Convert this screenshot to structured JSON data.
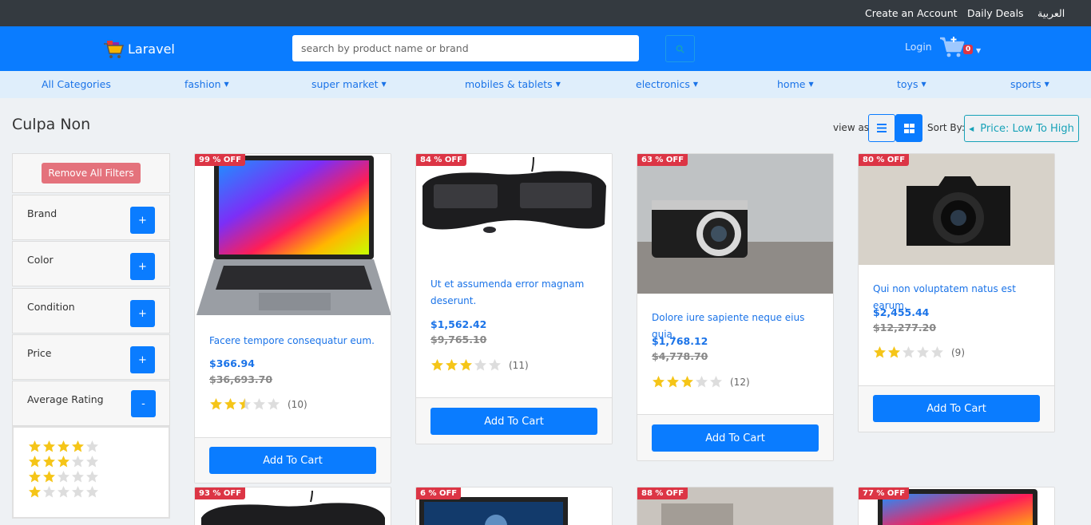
{
  "topbar": {
    "create_account": "Create an Account",
    "daily_deals": "Daily Deals",
    "arabic": "العربية"
  },
  "header": {
    "brand": "Laravel",
    "search_placeholder": "search by product name or brand",
    "login": "Login",
    "cart_count": "0"
  },
  "categories": [
    "All Categories",
    "fashion",
    "super market",
    "mobiles & tablets",
    "electronics",
    "home",
    "toys",
    "sports"
  ],
  "page": {
    "title": "Culpa Non",
    "view_as": "view as",
    "sort_by": "Sort By:",
    "sort_value": "Price: Low To High"
  },
  "sidebar": {
    "remove_all": "Remove All Filters",
    "filters": [
      {
        "label": "Brand",
        "sign": "+"
      },
      {
        "label": "Color",
        "sign": "+"
      },
      {
        "label": "Condition",
        "sign": "+"
      },
      {
        "label": "Price",
        "sign": "+"
      },
      {
        "label": "Average Rating",
        "sign": "-"
      }
    ],
    "rating_options": [
      4,
      3,
      2,
      1
    ]
  },
  "products": [
    {
      "discount": "99 % OFF",
      "title": "Facere tempore consequatur eum.",
      "price": "$366.94",
      "old_price": "$36,693.70",
      "rating": 2.5,
      "reviews": "(10)",
      "cta": "Add To Cart"
    },
    {
      "discount": "84 % OFF",
      "title": "Ut et assumenda error magnam deserunt.",
      "price": "$1,562.42",
      "old_price": "$9,765.10",
      "rating": 3,
      "reviews": "(11)",
      "cta": "Add To Cart"
    },
    {
      "discount": "63 % OFF",
      "title": "Dolore iure sapiente neque eius quia.",
      "price": "$1,768.12",
      "old_price": "$4,778.70",
      "rating": 3,
      "reviews": "(12)",
      "cta": "Add To Cart"
    },
    {
      "discount": "80 % OFF",
      "title": "Qui non voluptatem natus est earum.",
      "price": "$2,455.44",
      "old_price": "$12,277.20",
      "rating": 2,
      "reviews": "(9)",
      "cta": "Add To Cart"
    },
    {
      "discount": "93 % OFF"
    },
    {
      "discount": "6 % OFF"
    },
    {
      "discount": "88 % OFF"
    },
    {
      "discount": "77 % OFF"
    }
  ],
  "colors": {
    "topbar": "#343a40",
    "header": "#0a7cff",
    "catnav": "#dfeefb",
    "accent": "#0a7cff",
    "discount": "#dc3545",
    "star": "#f5c518",
    "star_empty": "#dddddd"
  },
  "icons": {
    "logo": "cart-logo-icon",
    "search": "search-icon",
    "cart": "cart-icon",
    "list_view": "list-view-icon",
    "grid_view": "grid-view-icon",
    "sort": "caret-left-icon"
  }
}
